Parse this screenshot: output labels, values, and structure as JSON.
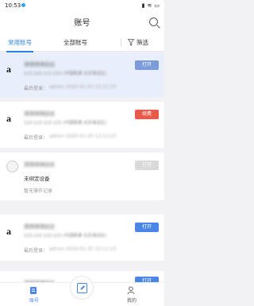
{
  "status_bar": {
    "time": "10:53"
  },
  "header": {
    "title": "账号"
  },
  "tabs": {
    "common": "常用账号",
    "all": "全部账号",
    "filter": "筛选"
  },
  "cards": [
    {
      "name": "测测测测达达",
      "sub": "123.123.123.123 (中国联通 北京海淀区)",
      "login_label": "最后登录：",
      "login_value": "admin   2020-01-20 13:11:23",
      "button": "打开",
      "button_color": "#7b9bd9"
    },
    {
      "name": "测测测测达达",
      "sub": "123.123.123.123 (中国联通 北京海淀区)",
      "login_label": "最后登录：",
      "login_value": "admin   2020-01-20 13:11:23",
      "button": "续费",
      "button_color": "#ea5a4a"
    },
    {
      "name": "测测测测达达",
      "status": "未绑定设备",
      "note": "暂无操作记录",
      "button": "打开",
      "button_color": "#d9d9d9"
    },
    {
      "name": "测测测测达达",
      "sub": "123.123.123.123 (中国联通 北京海淀区)",
      "login_label": "最后登录：",
      "login_value": "admin   2020-01-20 13:11:23",
      "button": "打开",
      "button_color": "#4a86e8"
    },
    {
      "name": "测测测测达达",
      "button": "打开",
      "button_color": "#4a86e8"
    }
  ],
  "bottom_nav": {
    "account": "账号",
    "mine": "我的"
  },
  "colors": {
    "accent": "#2a82e4"
  }
}
